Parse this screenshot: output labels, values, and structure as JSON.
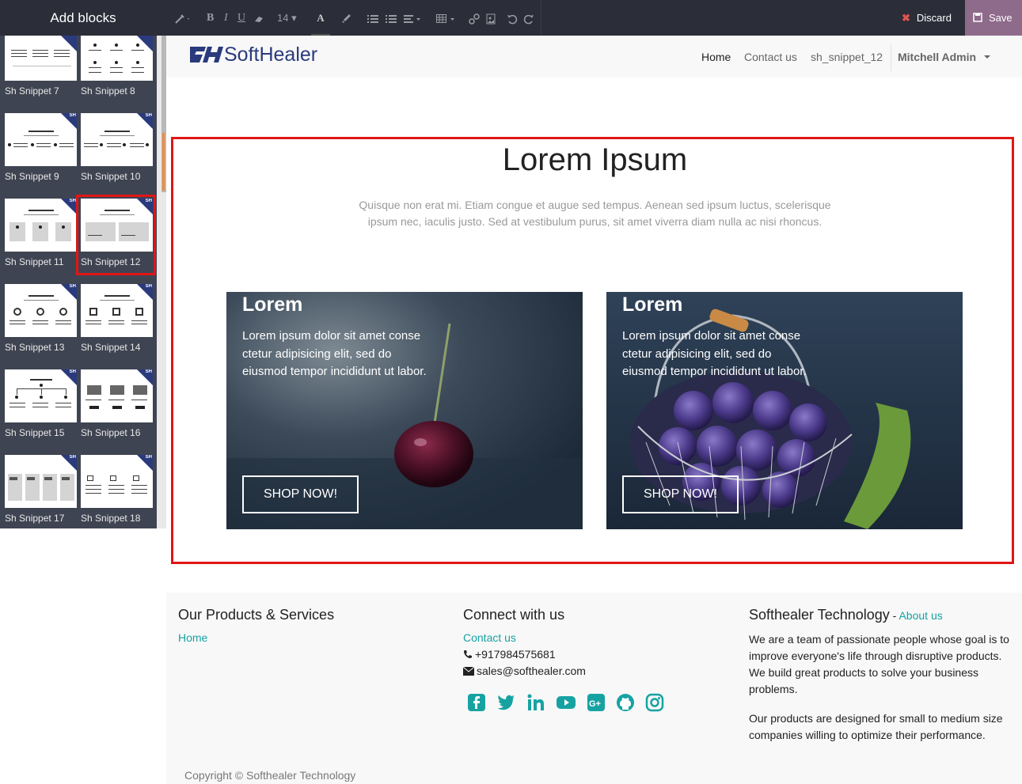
{
  "editor": {
    "panel_title": "Add blocks",
    "font_size": "14",
    "discard_label": "Discard",
    "save_label": "Save"
  },
  "snippets": [
    {
      "label": "Sh Snippet 7"
    },
    {
      "label": "Sh Snippet 8"
    },
    {
      "label": "Sh Snippet 9"
    },
    {
      "label": "Sh Snippet 10"
    },
    {
      "label": "Sh Snippet 11"
    },
    {
      "label": "Sh Snippet 12",
      "selected": true
    },
    {
      "label": "Sh Snippet 13"
    },
    {
      "label": "Sh Snippet 14"
    },
    {
      "label": "Sh Snippet 15"
    },
    {
      "label": "Sh Snippet 16"
    },
    {
      "label": "Sh Snippet 17"
    },
    {
      "label": "Sh Snippet 18"
    }
  ],
  "site": {
    "logo_text": "SoftHealer",
    "nav": {
      "home": "Home",
      "contact": "Contact us",
      "snippet": "sh_snippet_12",
      "user": "Mitchell Admin"
    }
  },
  "section": {
    "title": "Lorem Ipsum",
    "lead": "Quisque non erat mi. Etiam congue et augue sed tempus. Aenean sed ipsum luctus, scelerisque ipsum nec, iaculis justo. Sed at vestibulum purus, sit amet viverra diam nulla ac nisi rhoncus.",
    "cards": [
      {
        "title": "Lorem",
        "text": "Lorem ipsum dolor sit amet conse ctetur adipisicing elit, sed do eiusmod tempor incididunt ut labor.",
        "button": "SHOP NOW!"
      },
      {
        "title": "Lorem",
        "text": "Lorem ipsum dolor sit amet conse ctetur adipisicing elit, sed do eiusmod tempor incididunt ut labor.",
        "button": "SHOP NOW!"
      }
    ]
  },
  "footer": {
    "products_title": "Our Products & Services",
    "products_home": "Home",
    "connect_title": "Connect with us",
    "connect_contact": "Contact us",
    "phone": "+917984575681",
    "email": "sales@softhealer.com",
    "company_title": "Softhealer Technology",
    "company_sep": " - ",
    "about_link": "About us",
    "about_p1": "We are a team of passionate people whose goal is to improve everyone's life through disruptive products. We build great products to solve your business problems.",
    "about_p2": "Our products are designed for small to medium size companies willing to optimize their performance.",
    "copyright": "Copyright © Softhealer Technology",
    "social_icons": [
      "facebook-icon",
      "twitter-icon",
      "linkedin-icon",
      "youtube-icon",
      "google-plus-icon",
      "github-icon",
      "instagram-icon"
    ]
  },
  "colors": {
    "accent_teal": "#17a2a2",
    "toolbar_bg": "#2b2d38",
    "save_bg": "#8e6a8b",
    "selection_red": "#e01616"
  }
}
